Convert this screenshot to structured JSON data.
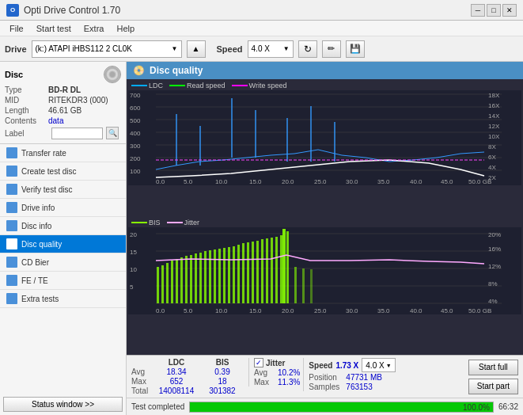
{
  "titlebar": {
    "title": "Opti Drive Control 1.70",
    "icon_text": "O",
    "btn_min": "—",
    "btn_max": "□",
    "btn_close": "✕"
  },
  "menubar": {
    "items": [
      "File",
      "Start test",
      "Extra",
      "Help"
    ]
  },
  "toolbar": {
    "drive_label": "Drive",
    "drive_value": "(k:) ATAPI iHBS112  2 CL0K",
    "eject_label": "▲",
    "speed_label": "Speed",
    "speed_value": "4.0 X",
    "icon1": "↻",
    "icon2": "🖊",
    "icon3": "💾"
  },
  "disc": {
    "section_label": "Disc",
    "type_label": "Type",
    "type_value": "BD-R DL",
    "mid_label": "MID",
    "mid_value": "RITEKDR3 (000)",
    "length_label": "Length",
    "length_value": "46.61 GB",
    "contents_label": "Contents",
    "contents_value": "data",
    "label_label": "Label",
    "label_value": ""
  },
  "nav_items": [
    {
      "id": "transfer-rate",
      "label": "Transfer rate",
      "active": false
    },
    {
      "id": "create-test-disc",
      "label": "Create test disc",
      "active": false
    },
    {
      "id": "verify-test-disc",
      "label": "Verify test disc",
      "active": false
    },
    {
      "id": "drive-info",
      "label": "Drive info",
      "active": false
    },
    {
      "id": "disc-info",
      "label": "Disc info",
      "active": false
    },
    {
      "id": "disc-quality",
      "label": "Disc quality",
      "active": true
    },
    {
      "id": "cd-bier",
      "label": "CD Bier",
      "active": false
    },
    {
      "id": "fe-te",
      "label": "FE / TE",
      "active": false
    },
    {
      "id": "extra-tests",
      "label": "Extra tests",
      "active": false
    }
  ],
  "status_btn": "Status window >>",
  "disc_quality": {
    "title": "Disc quality",
    "chart1": {
      "legend": [
        "LDC",
        "Read speed",
        "Write speed"
      ],
      "y_max": 700,
      "y_labels": [
        "700",
        "600",
        "500",
        "400",
        "300",
        "200",
        "100"
      ],
      "y_right_labels": [
        "18X",
        "16X",
        "14X",
        "12X",
        "10X",
        "8X",
        "6X",
        "4X",
        "2X"
      ],
      "x_labels": [
        "0.0",
        "5.0",
        "10.0",
        "15.0",
        "20.0",
        "25.0",
        "30.0",
        "35.0",
        "40.0",
        "45.0",
        "50.0 GB"
      ]
    },
    "chart2": {
      "legend": [
        "BIS",
        "Jitter"
      ],
      "y_max": 20,
      "y_labels": [
        "20",
        "15",
        "10",
        "5"
      ],
      "y_right_labels": [
        "20%",
        "16%",
        "12%",
        "8%",
        "4%"
      ],
      "x_labels": [
        "0.0",
        "5.0",
        "10.0",
        "15.0",
        "20.0",
        "25.0",
        "30.0",
        "35.0",
        "40.0",
        "45.0",
        "50.0 GB"
      ]
    }
  },
  "stats": {
    "col_ldc": "LDC",
    "col_bis": "BIS",
    "avg_label": "Avg",
    "avg_ldc": "18.34",
    "avg_bis": "0.39",
    "max_label": "Max",
    "max_ldc": "652",
    "max_bis": "18",
    "total_label": "Total",
    "total_ldc": "14008114",
    "total_bis": "301382",
    "jitter_label": "Jitter",
    "jitter_checked": true,
    "jitter_avg": "10.2%",
    "jitter_max": "11.3%",
    "jitter_avg_label": "Avg",
    "jitter_max_label": "Max",
    "speed_label": "Speed",
    "speed_value": "1.73 X",
    "speed_dropdown": "4.0 X",
    "position_label": "Position",
    "position_value": "47731 MB",
    "samples_label": "Samples",
    "samples_value": "763153",
    "btn_start_full": "Start full",
    "btn_start_part": "Start part"
  },
  "progress": {
    "status_text": "Test completed",
    "percent": "100.0%",
    "fill_width": 100,
    "value": "66:32"
  }
}
